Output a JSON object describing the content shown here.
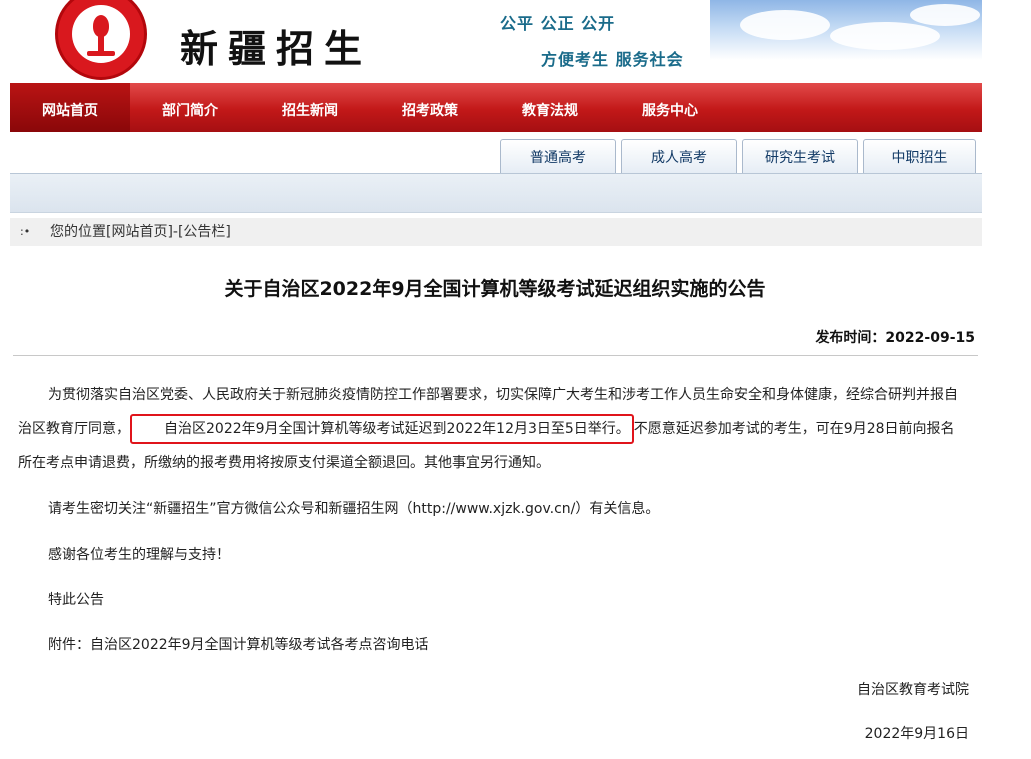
{
  "header": {
    "site_title": "新疆招生",
    "slogan_line1": "公平 公正 公开",
    "slogan_line2": "方便考生 服务社会"
  },
  "nav": {
    "items": [
      "网站首页",
      "部门简介",
      "招生新闻",
      "招考政策",
      "教育法规",
      "服务中心"
    ],
    "active_index": 0
  },
  "tabs": [
    "普通高考",
    "成人高考",
    "研究生考试",
    "中职招生"
  ],
  "breadcrumb": {
    "marker": ":•",
    "text": "您的位置[网站首页]-[公告栏]"
  },
  "article": {
    "title": "关于自治区2022年9月全国计算机等级考试延迟组织实施的公告",
    "publish_label": "发布时间：2022-09-15",
    "p1_before": "为贯彻落实自治区党委、人民政府关于新冠肺炎疫情防控工作部署要求，切实保障广大考生和涉考工作人员生命安全和身体健康，经综合研判并报自治区教育厅同意，",
    "p1_highlight": "自治区2022年9月全国计算机等级考试延迟到2022年12月3日至5日举行。",
    "p1_after": "不愿意延迟参加考试的考生，可在9月28日前向报名所在考点申请退费，所缴纳的报考费用将按原支付渠道全额退回。其他事宜另行通知。",
    "p2": "请考生密切关注“新疆招生”官方微信公众号和新疆招生网（http://www.xjzk.gov.cn/）有关信息。",
    "p3": "感谢各位考生的理解与支持！",
    "p4": "特此公告",
    "p5": "附件：自治区2022年9月全国计算机等级考试各考点咨询电话",
    "signature": "自治区教育考试院",
    "sign_date": "2022年9月16日"
  },
  "colors": {
    "nav_red": "#c21818",
    "highlight_border": "#e0141b",
    "slogan": "#1a6b8a"
  }
}
